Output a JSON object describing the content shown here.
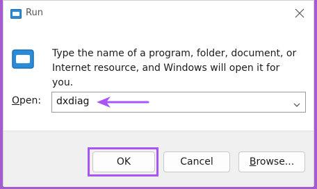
{
  "window": {
    "title": "Run"
  },
  "icons": {
    "app": "run-icon",
    "close": "close-icon",
    "dialog": "run-icon",
    "dropdown": "chevron-down-icon",
    "annotation": "arrow-left-icon"
  },
  "dialog": {
    "description": "Type the name of a program, folder, document, or Internet resource, and Windows will open it for you.",
    "open_label_mnemonic": "O",
    "open_label_rest": "pen:",
    "open_value": "dxdiag"
  },
  "buttons": {
    "ok": "OK",
    "cancel": "Cancel",
    "browse_mnemonic": "B",
    "browse_rest": "rowse..."
  },
  "colors": {
    "highlight": "#a855f7",
    "background": "#a55bd0"
  }
}
